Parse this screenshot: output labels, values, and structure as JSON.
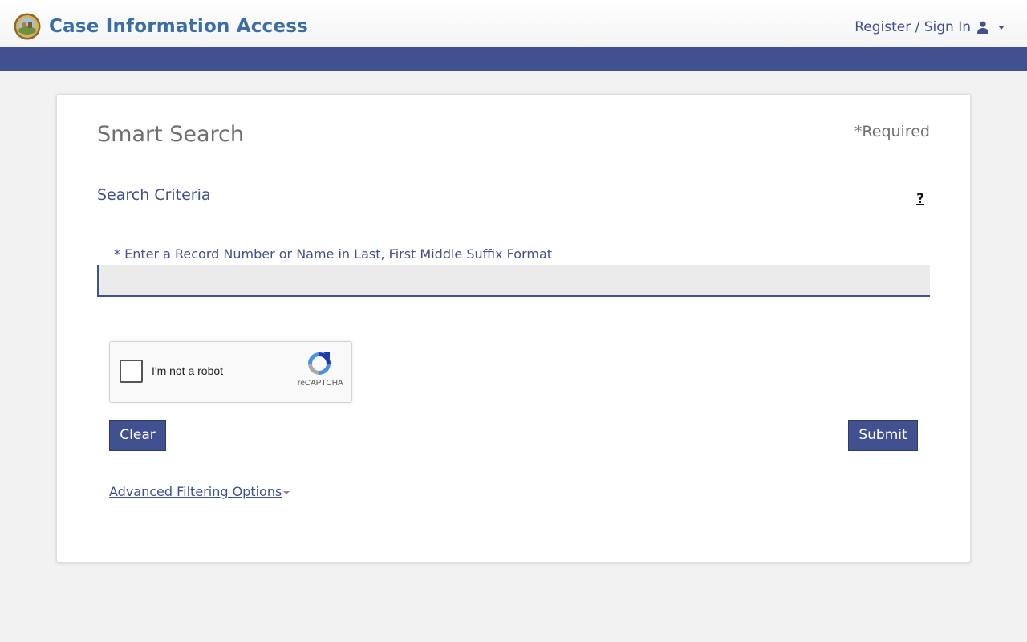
{
  "header": {
    "title": "Case Information Access",
    "signin_label": "Register / Sign In",
    "user_icon": "user-icon",
    "seal_icon": "state-seal-icon",
    "accent_color": "#41508f",
    "title_color": "#3a6ea5"
  },
  "main": {
    "title": "Smart Search",
    "required_note": "*Required",
    "section_title": "Search Criteria",
    "help_label": "?",
    "field_label": "* Enter a Record Number or Name in Last, First Middle Suffix Format",
    "search_value": "",
    "search_placeholder": ""
  },
  "recaptcha": {
    "label": "I'm not a robot",
    "brand": "reCAPTCHA"
  },
  "buttons": {
    "clear_label": "Clear",
    "submit_label": "Submit"
  },
  "advanced": {
    "label": "Advanced Filtering Options"
  }
}
